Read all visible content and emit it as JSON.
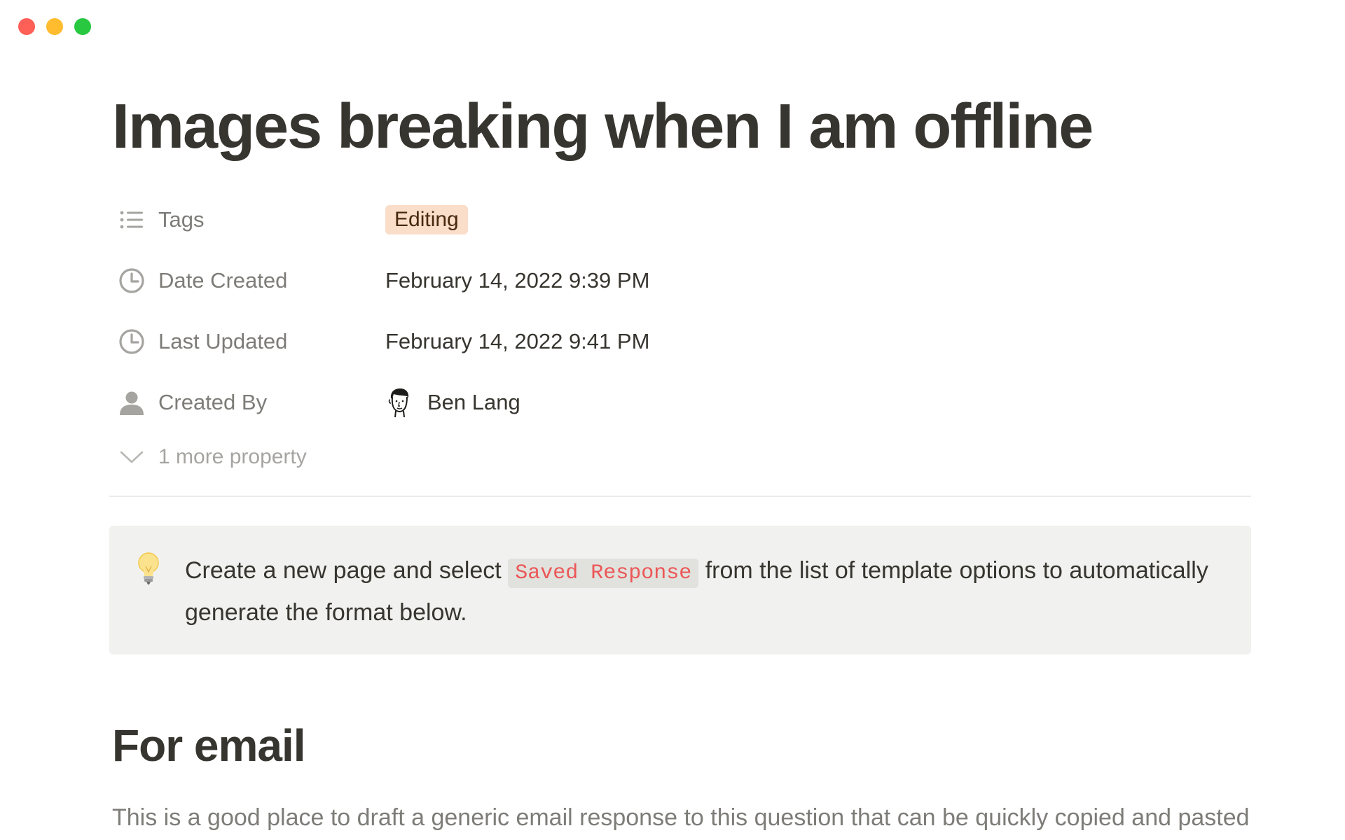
{
  "window": {
    "controls": [
      "close",
      "minimize",
      "maximize"
    ],
    "colors": {
      "close": "#fe5f57",
      "minimize": "#febc2e",
      "maximize": "#28c840"
    }
  },
  "page": {
    "title": "Images breaking when I am offline"
  },
  "properties": [
    {
      "icon": "list-icon",
      "label": "Tags",
      "value": "Editing",
      "type": "tag",
      "tag_color": "#fadec9"
    },
    {
      "icon": "clock-icon",
      "label": "Date Created",
      "value": "February 14, 2022 9:39 PM",
      "type": "date"
    },
    {
      "icon": "clock-icon",
      "label": "Last Updated",
      "value": "February 14, 2022 9:41 PM",
      "type": "date"
    },
    {
      "icon": "person-icon",
      "label": "Created By",
      "value": "Ben Lang",
      "type": "person"
    }
  ],
  "more_properties": {
    "icon": "chevron-down-icon",
    "label": "1 more property"
  },
  "callout": {
    "icon": "lightbulb-icon",
    "text_before": "Create a new page and select ",
    "code": "Saved Response",
    "text_after": " from the list of template options to automatically generate the format below."
  },
  "section": {
    "heading": "For email",
    "body": "This is a good place to draft a generic email response to this question that can be quickly copied and pasted into your reply so far as possible. Example:"
  }
}
